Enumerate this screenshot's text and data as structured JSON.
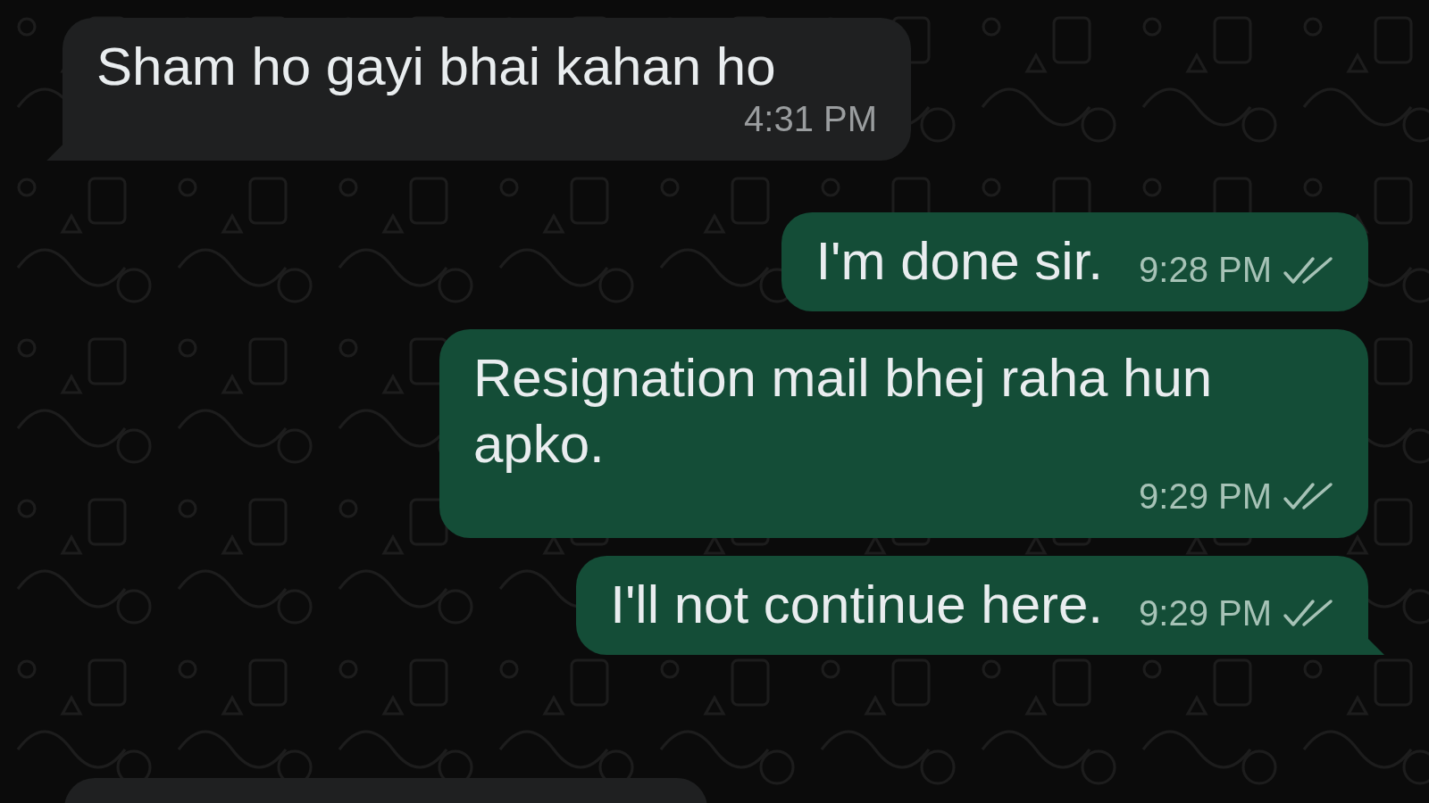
{
  "messages": [
    {
      "kind": "incoming",
      "text": "Sham ho gayi bhai kahan ho",
      "time": "4:31 PM",
      "tail": true
    },
    {
      "kind": "outgoing",
      "text": "I'm done sir.",
      "time": "9:28 PM",
      "read": false,
      "tail": false
    },
    {
      "kind": "outgoing",
      "text": "Resignation mail bhej raha hun apko.",
      "time": "9:29 PM",
      "read": false,
      "tail": false
    },
    {
      "kind": "outgoing",
      "text": "I'll not continue here.",
      "time": "9:29 PM",
      "read": false,
      "tail": true
    }
  ]
}
